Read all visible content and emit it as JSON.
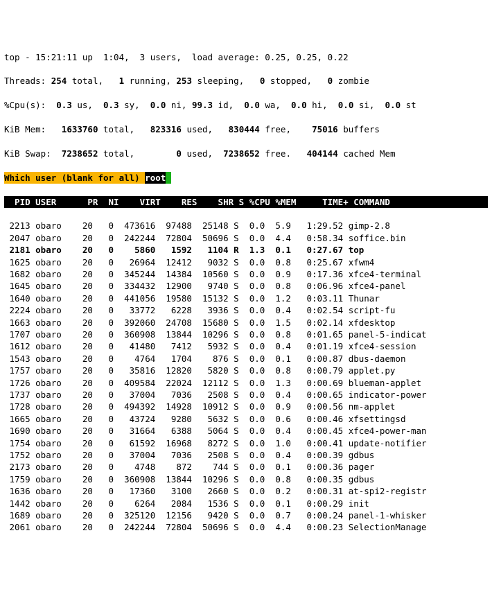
{
  "summary": {
    "line1": "top - 15:21:11 up  1:04,  3 users,  load average: 0.25, 0.25, 0.22",
    "threads_label": "Threads:",
    "threads_total": " 254 ",
    "threads_total_lbl": "total,   ",
    "threads_running": "1 ",
    "threads_running_lbl": "running, ",
    "threads_sleeping": "253 ",
    "threads_sleeping_lbl": "sleeping,   ",
    "threads_stopped": "0 ",
    "threads_stopped_lbl": "stopped,   ",
    "threads_zombie": "0 ",
    "threads_zombie_lbl": "zombie",
    "cpu_label": "%Cpu(s):  ",
    "cpu_us": "0.3 ",
    "cpu_us_lbl": "us,  ",
    "cpu_sy": "0.3 ",
    "cpu_sy_lbl": "sy,  ",
    "cpu_ni": "0.0 ",
    "cpu_ni_lbl": "ni, ",
    "cpu_id": "99.3 ",
    "cpu_id_lbl": "id,  ",
    "cpu_wa": "0.0 ",
    "cpu_wa_lbl": "wa,  ",
    "cpu_hi": "0.0 ",
    "cpu_hi_lbl": "hi,  ",
    "cpu_si": "0.0 ",
    "cpu_si_lbl": "si,  ",
    "cpu_st": "0.0 ",
    "cpu_st_lbl": "st",
    "mem_label": "KiB Mem:   ",
    "mem_total": "1633760 ",
    "mem_total_lbl": "total,   ",
    "mem_used": "823316 ",
    "mem_used_lbl": "used,   ",
    "mem_free": "830444 ",
    "mem_free_lbl": "free,    ",
    "mem_buf": "75016 ",
    "mem_buf_lbl": "buffers",
    "swap_label": "KiB Swap:  ",
    "swap_total": "7238652 ",
    "swap_total_lbl": "total,        ",
    "swap_used": "0 ",
    "swap_used_lbl": "used,  ",
    "swap_free": "7238652 ",
    "swap_free_lbl": "free.   ",
    "swap_cache": "404144 ",
    "swap_cache_lbl": "cached Mem"
  },
  "prompt": {
    "label": "Which user (blank for all) ",
    "value": "root",
    "cursor": " "
  },
  "columns": "  PID USER      PR  NI    VIRT    RES    SHR S %CPU %MEM     TIME+ COMMAND          ",
  "rows": [
    {
      "pid": " 2213",
      "user": "obaro",
      "pr": "20",
      "ni": "0",
      "virt": " 473616",
      "res": " 97488",
      "shr": " 25148",
      "s": "S",
      "cpu": " 0.0",
      "mem": " 5.9",
      "time": "  1:29.52",
      "cmd": "gimp-2.8",
      "bold": false
    },
    {
      "pid": " 2047",
      "user": "obaro",
      "pr": "20",
      "ni": "0",
      "virt": " 242244",
      "res": " 72804",
      "shr": " 50696",
      "s": "S",
      "cpu": " 0.0",
      "mem": " 4.4",
      "time": "  0:58.34",
      "cmd": "soffice.bin",
      "bold": false
    },
    {
      "pid": " 2181",
      "user": "obaro",
      "pr": "20",
      "ni": "0",
      "virt": "   5860",
      "res": "  1592",
      "shr": "  1104",
      "s": "R",
      "cpu": " 1.3",
      "mem": " 0.1",
      "time": "  0:27.67",
      "cmd": "top",
      "bold": true
    },
    {
      "pid": " 1625",
      "user": "obaro",
      "pr": "20",
      "ni": "0",
      "virt": "  26964",
      "res": " 12412",
      "shr": "  9032",
      "s": "S",
      "cpu": " 0.0",
      "mem": " 0.8",
      "time": "  0:25.67",
      "cmd": "xfwm4",
      "bold": false
    },
    {
      "pid": " 1682",
      "user": "obaro",
      "pr": "20",
      "ni": "0",
      "virt": " 345244",
      "res": " 14384",
      "shr": " 10560",
      "s": "S",
      "cpu": " 0.0",
      "mem": " 0.9",
      "time": "  0:17.36",
      "cmd": "xfce4-terminal",
      "bold": false
    },
    {
      "pid": " 1645",
      "user": "obaro",
      "pr": "20",
      "ni": "0",
      "virt": " 334432",
      "res": " 12900",
      "shr": "  9740",
      "s": "S",
      "cpu": " 0.0",
      "mem": " 0.8",
      "time": "  0:06.96",
      "cmd": "xfce4-panel",
      "bold": false
    },
    {
      "pid": " 1640",
      "user": "obaro",
      "pr": "20",
      "ni": "0",
      "virt": " 441056",
      "res": " 19580",
      "shr": " 15132",
      "s": "S",
      "cpu": " 0.0",
      "mem": " 1.2",
      "time": "  0:03.11",
      "cmd": "Thunar",
      "bold": false
    },
    {
      "pid": " 2224",
      "user": "obaro",
      "pr": "20",
      "ni": "0",
      "virt": "  33772",
      "res": "  6228",
      "shr": "  3936",
      "s": "S",
      "cpu": " 0.0",
      "mem": " 0.4",
      "time": "  0:02.54",
      "cmd": "script-fu",
      "bold": false
    },
    {
      "pid": " 1663",
      "user": "obaro",
      "pr": "20",
      "ni": "0",
      "virt": " 392060",
      "res": " 24708",
      "shr": " 15680",
      "s": "S",
      "cpu": " 0.0",
      "mem": " 1.5",
      "time": "  0:02.14",
      "cmd": "xfdesktop",
      "bold": false
    },
    {
      "pid": " 1707",
      "user": "obaro",
      "pr": "20",
      "ni": "0",
      "virt": " 360908",
      "res": " 13844",
      "shr": " 10296",
      "s": "S",
      "cpu": " 0.0",
      "mem": " 0.8",
      "time": "  0:01.65",
      "cmd": "panel-5-indicat",
      "bold": false
    },
    {
      "pid": " 1612",
      "user": "obaro",
      "pr": "20",
      "ni": "0",
      "virt": "  41480",
      "res": "  7412",
      "shr": "  5932",
      "s": "S",
      "cpu": " 0.0",
      "mem": " 0.4",
      "time": "  0:01.19",
      "cmd": "xfce4-session",
      "bold": false
    },
    {
      "pid": " 1543",
      "user": "obaro",
      "pr": "20",
      "ni": "0",
      "virt": "   4764",
      "res": "  1704",
      "shr": "   876",
      "s": "S",
      "cpu": " 0.0",
      "mem": " 0.1",
      "time": "  0:00.87",
      "cmd": "dbus-daemon",
      "bold": false
    },
    {
      "pid": " 1757",
      "user": "obaro",
      "pr": "20",
      "ni": "0",
      "virt": "  35816",
      "res": " 12820",
      "shr": "  5820",
      "s": "S",
      "cpu": " 0.0",
      "mem": " 0.8",
      "time": "  0:00.79",
      "cmd": "applet.py",
      "bold": false
    },
    {
      "pid": " 1726",
      "user": "obaro",
      "pr": "20",
      "ni": "0",
      "virt": " 409584",
      "res": " 22024",
      "shr": " 12112",
      "s": "S",
      "cpu": " 0.0",
      "mem": " 1.3",
      "time": "  0:00.69",
      "cmd": "blueman-applet",
      "bold": false
    },
    {
      "pid": " 1737",
      "user": "obaro",
      "pr": "20",
      "ni": "0",
      "virt": "  37004",
      "res": "  7036",
      "shr": "  2508",
      "s": "S",
      "cpu": " 0.0",
      "mem": " 0.4",
      "time": "  0:00.65",
      "cmd": "indicator-power",
      "bold": false
    },
    {
      "pid": " 1728",
      "user": "obaro",
      "pr": "20",
      "ni": "0",
      "virt": " 494392",
      "res": " 14928",
      "shr": " 10912",
      "s": "S",
      "cpu": " 0.0",
      "mem": " 0.9",
      "time": "  0:00.56",
      "cmd": "nm-applet",
      "bold": false
    },
    {
      "pid": " 1665",
      "user": "obaro",
      "pr": "20",
      "ni": "0",
      "virt": "  43724",
      "res": "  9280",
      "shr": "  5632",
      "s": "S",
      "cpu": " 0.0",
      "mem": " 0.6",
      "time": "  0:00.46",
      "cmd": "xfsettingsd",
      "bold": false
    },
    {
      "pid": " 1690",
      "user": "obaro",
      "pr": "20",
      "ni": "0",
      "virt": "  31664",
      "res": "  6388",
      "shr": "  5064",
      "s": "S",
      "cpu": " 0.0",
      "mem": " 0.4",
      "time": "  0:00.45",
      "cmd": "xfce4-power-man",
      "bold": false
    },
    {
      "pid": " 1754",
      "user": "obaro",
      "pr": "20",
      "ni": "0",
      "virt": "  61592",
      "res": " 16968",
      "shr": "  8272",
      "s": "S",
      "cpu": " 0.0",
      "mem": " 1.0",
      "time": "  0:00.41",
      "cmd": "update-notifier",
      "bold": false
    },
    {
      "pid": " 1752",
      "user": "obaro",
      "pr": "20",
      "ni": "0",
      "virt": "  37004",
      "res": "  7036",
      "shr": "  2508",
      "s": "S",
      "cpu": " 0.0",
      "mem": " 0.4",
      "time": "  0:00.39",
      "cmd": "gdbus",
      "bold": false
    },
    {
      "pid": " 2173",
      "user": "obaro",
      "pr": "20",
      "ni": "0",
      "virt": "   4748",
      "res": "   872",
      "shr": "   744",
      "s": "S",
      "cpu": " 0.0",
      "mem": " 0.1",
      "time": "  0:00.36",
      "cmd": "pager",
      "bold": false
    },
    {
      "pid": " 1759",
      "user": "obaro",
      "pr": "20",
      "ni": "0",
      "virt": " 360908",
      "res": " 13844",
      "shr": " 10296",
      "s": "S",
      "cpu": " 0.0",
      "mem": " 0.8",
      "time": "  0:00.35",
      "cmd": "gdbus",
      "bold": false
    },
    {
      "pid": " 1636",
      "user": "obaro",
      "pr": "20",
      "ni": "0",
      "virt": "  17360",
      "res": "  3100",
      "shr": "  2660",
      "s": "S",
      "cpu": " 0.0",
      "mem": " 0.2",
      "time": "  0:00.31",
      "cmd": "at-spi2-registr",
      "bold": false
    },
    {
      "pid": " 1442",
      "user": "obaro",
      "pr": "20",
      "ni": "0",
      "virt": "   6264",
      "res": "  2084",
      "shr": "  1536",
      "s": "S",
      "cpu": " 0.0",
      "mem": " 0.1",
      "time": "  0:00.29",
      "cmd": "init",
      "bold": false
    },
    {
      "pid": " 1689",
      "user": "obaro",
      "pr": "20",
      "ni": "0",
      "virt": " 325120",
      "res": " 12156",
      "shr": "  9420",
      "s": "S",
      "cpu": " 0.0",
      "mem": " 0.7",
      "time": "  0:00.24",
      "cmd": "panel-1-whisker",
      "bold": false
    },
    {
      "pid": " 2061",
      "user": "obaro",
      "pr": "20",
      "ni": "0",
      "virt": " 242244",
      "res": " 72804",
      "shr": " 50696",
      "s": "S",
      "cpu": " 0.0",
      "mem": " 4.4",
      "time": "  0:00.23",
      "cmd": "SelectionManage",
      "bold": false
    }
  ]
}
